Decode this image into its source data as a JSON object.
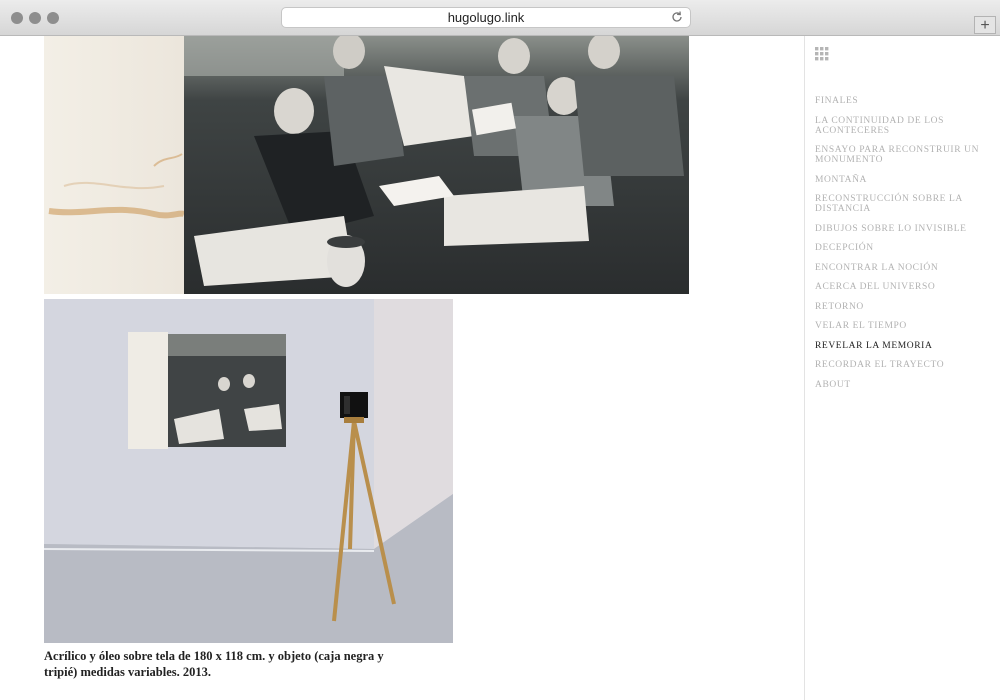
{
  "browser": {
    "url": "hugolugo.link",
    "new_tab_label": "+"
  },
  "artwork": {
    "caption": "Acrílico y óleo sobre tela de 180 x 118 cm. y objeto (caja negra y tripié) medidas variables. 2013."
  },
  "sidebar": {
    "items": [
      {
        "label": "FINALES"
      },
      {
        "label": "LA CONTINUIDAD DE LOS ACONTECERES"
      },
      {
        "label": "ENSAYO PARA RECONSTRUIR UN MONUMENTO"
      },
      {
        "label": "MONTAÑA"
      },
      {
        "label": "RECONSTRUCCIÓN SOBRE LA DISTANCIA"
      },
      {
        "label": "DIBUJOS SOBRE LO INVISIBLE"
      },
      {
        "label": "DECEPCIÓN"
      },
      {
        "label": "ENCONTRAR LA NOCIÓN"
      },
      {
        "label": "ACERCA DEL UNIVERSO"
      },
      {
        "label": "RETORNO"
      },
      {
        "label": "VELAR EL TIEMPO"
      },
      {
        "label": "REVELAR LA MEMORIA"
      },
      {
        "label": "RECORDAR EL TRAYECTO"
      },
      {
        "label": "ABOUT"
      }
    ],
    "active_index": 11
  }
}
